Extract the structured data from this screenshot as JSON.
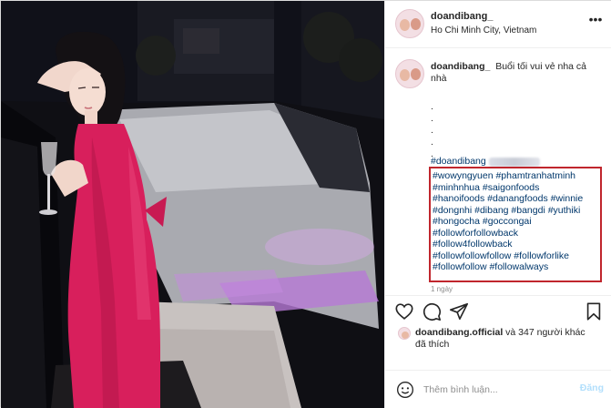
{
  "header": {
    "username": "doandibang_",
    "location": "Ho Chi Minh City, Vietnam"
  },
  "caption": {
    "username": "doandibang_",
    "text": "Buổi tối vui vẻ nha cả nhà",
    "dots": [
      ".",
      ".",
      ".",
      ".",
      "."
    ],
    "main_tag": "#doandibang",
    "highlighted_tags": [
      "#wowyngyuen #phamtranhatminh",
      "#minhnhua #saigonfoods",
      "#hanoifoods #danangfoods #winnie",
      "#dongnhi #dibang #bangdi #yuthiki",
      "#hongocha #goccongai",
      "#followforfollowback",
      "#follow4followback",
      "#followfollowfollow #followforlike",
      "#followfollow #followalways"
    ],
    "date": "1 ngày"
  },
  "likes": {
    "user": "doandibang.official",
    "rest": " và 347 người khác",
    "line2": "đã thích"
  },
  "comment": {
    "placeholder": "Thêm bình luận...",
    "post_label": "Đăng"
  },
  "colors": {
    "highlight_box": "#c0262d",
    "hashtag": "#00376b",
    "dress": "#d81f5c"
  },
  "icons": [
    "heart-icon",
    "comment-icon",
    "share-icon",
    "bookmark-icon",
    "emoji-icon",
    "more-icon"
  ]
}
